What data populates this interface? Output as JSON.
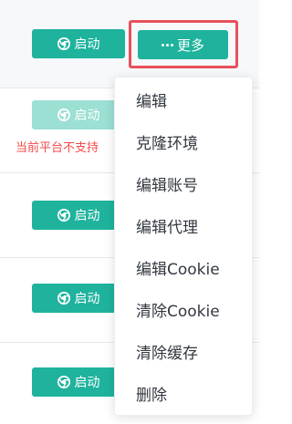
{
  "rows": [
    {
      "start_label": "启动",
      "disabled": false
    },
    {
      "start_label": "启动",
      "disabled": true,
      "warning": "当前平台不支持"
    },
    {
      "start_label": "启动",
      "disabled": false
    },
    {
      "start_label": "启动",
      "disabled": false
    },
    {
      "start_label": "启动",
      "disabled": false
    }
  ],
  "more_button": {
    "label": "更多"
  },
  "menu": {
    "items": [
      "编辑",
      "克隆环境",
      "编辑账号",
      "编辑代理",
      "编辑Cookie",
      "清除Cookie",
      "清除缓存",
      "删除"
    ]
  },
  "colors": {
    "primary": "#1fb39d",
    "primary_disabled": "#9be0d3",
    "warning_text": "#f24b4b",
    "highlight": "#e8515b"
  },
  "icons": {
    "start": "chrome-icon",
    "more": "more-dots-icon"
  }
}
